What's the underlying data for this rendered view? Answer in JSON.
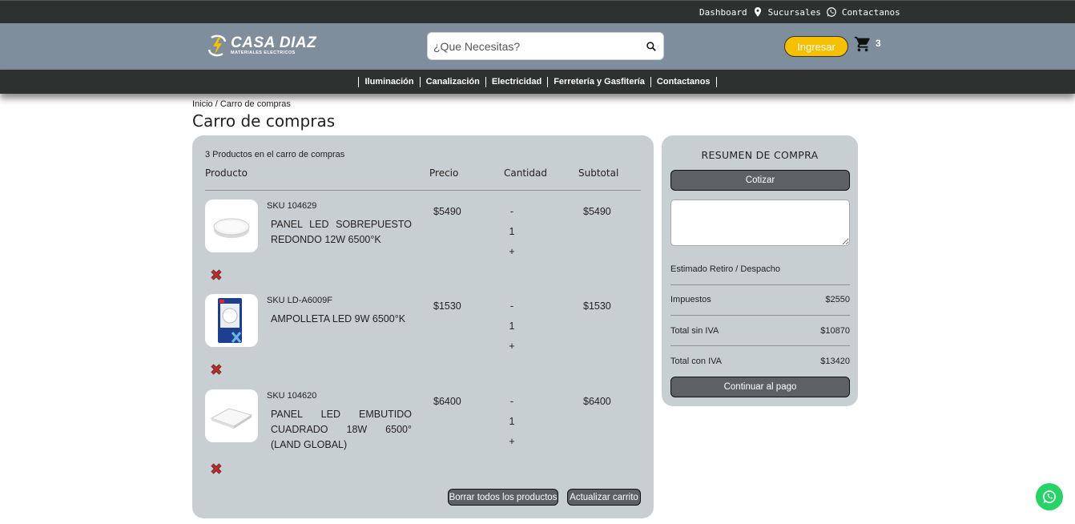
{
  "topbar": {
    "dashboard": "Dashboard",
    "sucursales": "Sucursales",
    "contactanos": "Contactanos"
  },
  "brand": {
    "name": "CASA DIAZ",
    "tagline": "MATERIALES ELECTRICOS",
    "accent": "#f5c000"
  },
  "search": {
    "placeholder": "¿Que Necesitas?"
  },
  "header": {
    "login_label": "Ingresar",
    "cart_count": "3"
  },
  "nav": {
    "items": [
      "Iluminación",
      "Canalización",
      "Electricidad",
      "Ferretería y Gasfitería",
      "Contactanos"
    ]
  },
  "breadcrumb": "Inicio / Carro de compras",
  "page_title": "Carro de compras",
  "cart": {
    "count_label": "3 Productos en el carro de compras",
    "columns": {
      "product": "Producto",
      "price": "Precio",
      "quantity": "Cantidad",
      "subtotal": "Subtotal"
    },
    "items": [
      {
        "sku": "SKU 104629",
        "name": "PANEL LED SOBREPUESTO REDONDO 12W 6500°K",
        "price": "$5490",
        "minus": "-",
        "qty": "1",
        "plus": "+",
        "subtotal": "$5490"
      },
      {
        "sku": "SKU LD-A6009F",
        "name": "AMPOLLETA LED 9W 6500°K",
        "price": "$1530",
        "minus": "-",
        "qty": "1",
        "plus": "+",
        "subtotal": "$1530"
      },
      {
        "sku": "SKU 104620",
        "name": "PANEL LED EMBUTIDO CUADRADO 18W 6500° (LAND GLOBAL)",
        "price": "$6400",
        "minus": "-",
        "qty": "1",
        "plus": "+",
        "subtotal": "$6400"
      }
    ],
    "clear_label": "Borrar todos los productos",
    "update_label": "Actualizar carrito"
  },
  "summary": {
    "title": "RESUMEN DE COMPRA",
    "quote_label": "Cotizar",
    "estimate_label": "Estimado Retiro / Despacho",
    "taxes_label": "Impuestos",
    "taxes_value": "$2550",
    "total_no_tax_label": "Total sin IVA",
    "total_no_tax_value": "$10870",
    "total_tax_label": "Total con IVA",
    "total_tax_value": "$13420",
    "pay_label": "Continuar al pago"
  }
}
